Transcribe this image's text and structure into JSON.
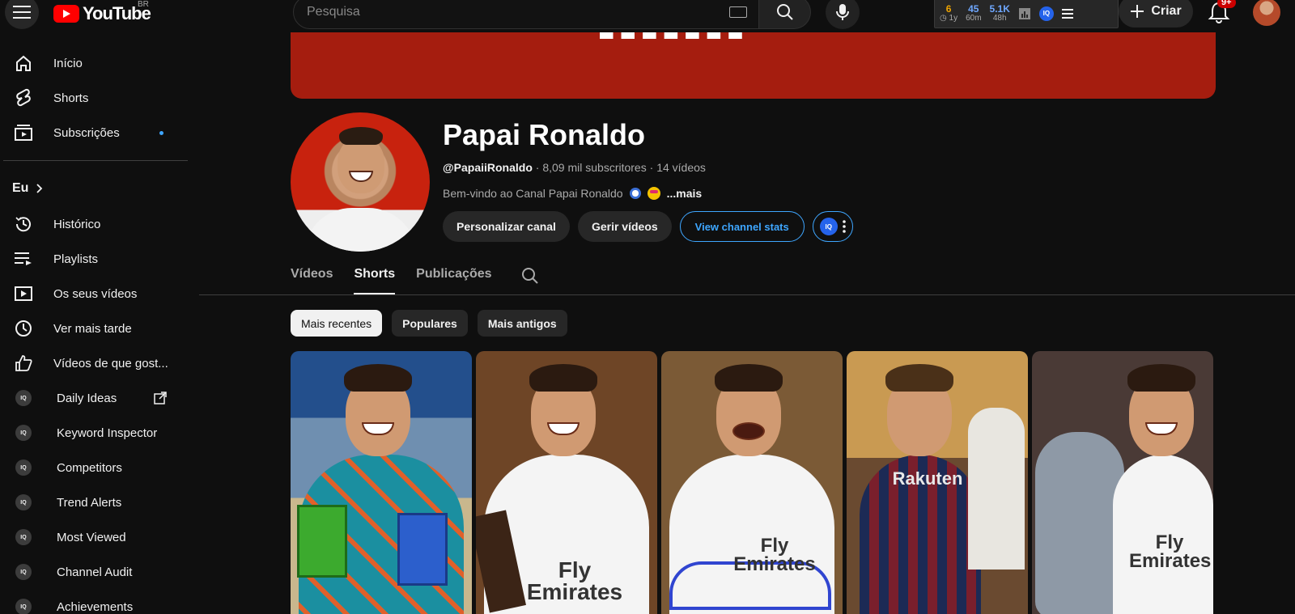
{
  "topbar": {
    "logo_text": "YouTube",
    "country_code": "BR",
    "search_placeholder": "Pesquisa",
    "stats": [
      {
        "value": "6",
        "label": "1y",
        "color": "#f0a500"
      },
      {
        "value": "45",
        "label": "60m",
        "color": "#6fa8ff"
      },
      {
        "value": "5.1K",
        "label": "48h",
        "color": "#6fa8ff"
      }
    ],
    "create_label": "Criar",
    "notification_count": "9+"
  },
  "sidebar": {
    "main": [
      {
        "label": "Início",
        "icon": "home-icon"
      },
      {
        "label": "Shorts",
        "icon": "shorts-icon"
      },
      {
        "label": "Subscrições",
        "icon": "subscriptions-icon"
      }
    ],
    "section_title": "Eu",
    "you": [
      {
        "label": "Histórico",
        "icon": "history-icon"
      },
      {
        "label": "Playlists",
        "icon": "playlists-icon"
      },
      {
        "label": "Os seus vídeos",
        "icon": "your-videos-icon"
      },
      {
        "label": "Ver mais tarde",
        "icon": "watch-later-icon"
      },
      {
        "label": "Vídeos de que gost...",
        "icon": "liked-icon"
      }
    ],
    "extension": [
      {
        "label": "Daily Ideas",
        "icon": "vidiq-icon"
      },
      {
        "label": "Keyword Inspector",
        "icon": "vidiq-icon"
      },
      {
        "label": "Competitors",
        "icon": "vidiq-icon"
      },
      {
        "label": "Trend Alerts",
        "icon": "vidiq-icon"
      },
      {
        "label": "Most Viewed",
        "icon": "vidiq-icon"
      },
      {
        "label": "Channel Audit",
        "icon": "vidiq-icon"
      },
      {
        "label": "Achievements",
        "icon": "vidiq-icon"
      }
    ],
    "ext_icon_text": "IQ"
  },
  "channel": {
    "name": "Papai Ronaldo",
    "handle": "@PapaiiRonaldo",
    "subscribers": "8,09 mil subscritores",
    "videos": "14 vídeos",
    "separator": "·",
    "description": "Bem-vindo ao Canal Papai Ronaldo",
    "more": "...mais",
    "buttons": {
      "customize": "Personalizar canal",
      "manage": "Gerir vídeos",
      "stats": "View channel stats",
      "iq": "IQ"
    }
  },
  "tabs": [
    {
      "label": "Vídeos",
      "active": false
    },
    {
      "label": "Shorts",
      "active": true
    },
    {
      "label": "Publicações",
      "active": false
    }
  ],
  "chips": [
    {
      "label": "Mais recentes",
      "active": true
    },
    {
      "label": "Populares",
      "active": false
    },
    {
      "label": "Mais antigos",
      "active": false
    }
  ],
  "shorts": [
    {
      "bg": "#7a8fa6",
      "shirt": "#1f9aa8",
      "label": ""
    },
    {
      "bg": "#8a5a32",
      "shirt": "#f4f4f4",
      "label": "Fly\nEmirates"
    },
    {
      "bg": "#8a6a42",
      "shirt": "#f4f4f4",
      "label": "Fly\nEmirates"
    },
    {
      "bg": "#a77a3c",
      "shirt": "#7a1f2c",
      "label": "Rakuten"
    },
    {
      "bg": "#5a4a45",
      "shirt": "#f4f4f4",
      "label": "Fly\nEmirates"
    }
  ]
}
